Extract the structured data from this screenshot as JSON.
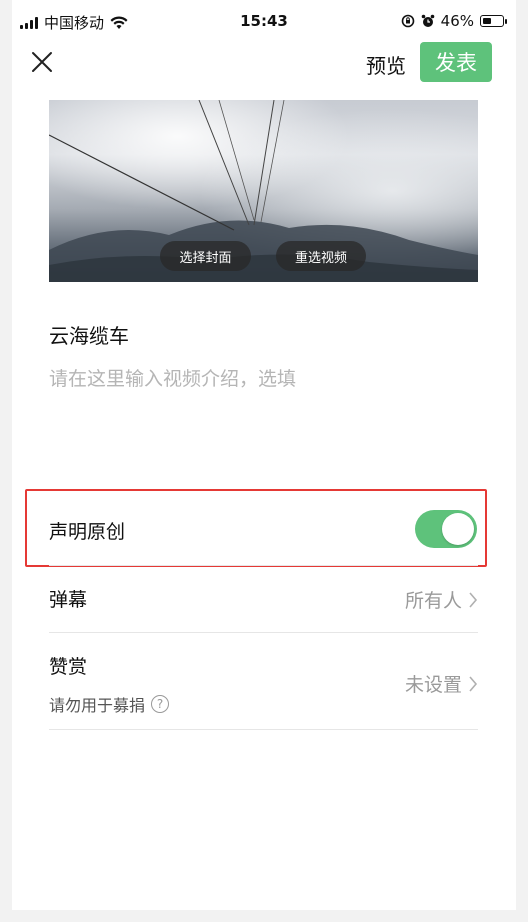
{
  "status_bar": {
    "carrier": "中国移动",
    "time": "15:43",
    "battery": "46%",
    "battery_level": 0.46
  },
  "nav": {
    "close_icon": "close-icon",
    "preview_label": "预览",
    "publish_label": "发表"
  },
  "cover": {
    "choose_cover_label": "选择封面",
    "reselect_video_label": "重选视频"
  },
  "post": {
    "title": "云海缆车",
    "description_placeholder": "请在这里输入视频介绍，选填"
  },
  "settings": {
    "original": {
      "label": "声明原创",
      "enabled": true
    },
    "danmaku": {
      "label": "弹幕",
      "value": "所有人"
    },
    "reward": {
      "label": "赞赏",
      "sub_label": "请勿用于募捐",
      "help_symbol": "?",
      "value": "未设置"
    }
  },
  "colors": {
    "accent_green": "#5ec27b",
    "highlight_red": "#e53935"
  }
}
